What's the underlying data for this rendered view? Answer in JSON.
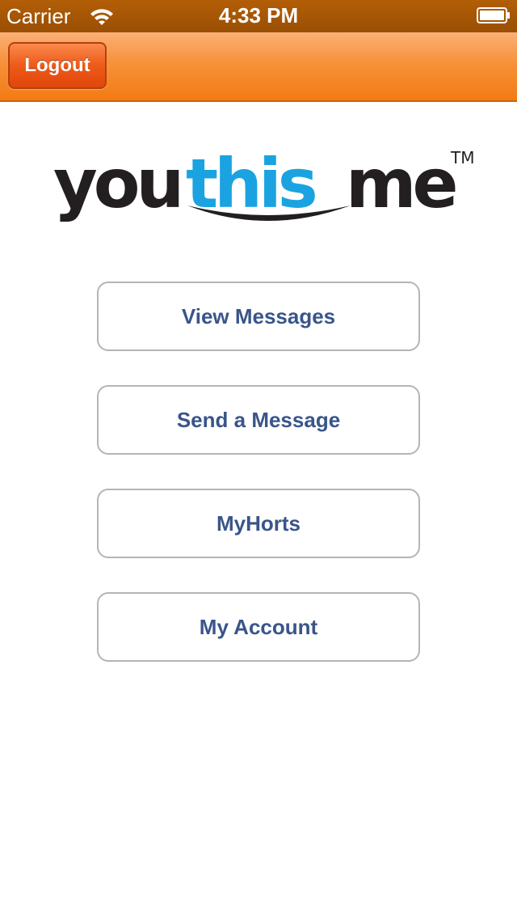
{
  "status_bar": {
    "carrier": "Carrier",
    "time": "4:33 PM",
    "wifi_icon": "wifi-icon",
    "battery_icon": "battery-icon"
  },
  "nav_bar": {
    "logout_label": "Logout",
    "accent_color": "#f27b12",
    "button_color": "#e1470a"
  },
  "logo": {
    "part1": "you",
    "part2": "this",
    "part3": "me",
    "trademark": "TM",
    "dark_color": "#231f20",
    "accent_color": "#1aa3e0"
  },
  "menu": {
    "items": [
      {
        "label": "View Messages"
      },
      {
        "label": "Send a Message"
      },
      {
        "label": "MyHorts"
      },
      {
        "label": "My Account"
      }
    ],
    "text_color": "#39558a"
  }
}
